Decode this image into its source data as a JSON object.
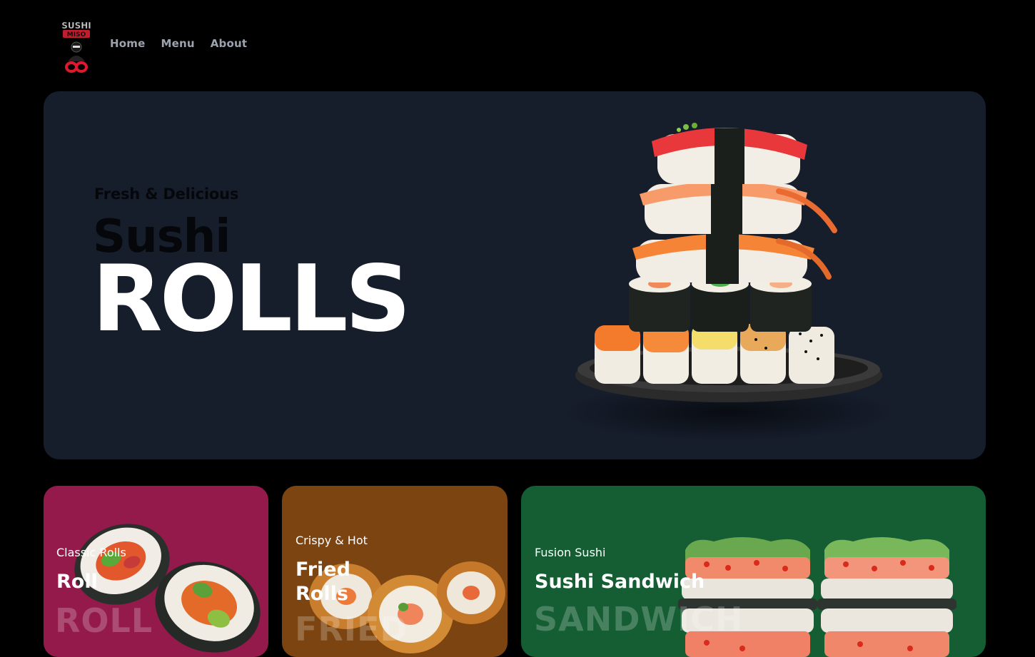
{
  "header": {
    "logo_text_top": "SUSHI",
    "logo_text_bottom": "MISO",
    "nav": [
      {
        "label": "Home"
      },
      {
        "label": "Menu"
      },
      {
        "label": "About"
      }
    ]
  },
  "hero": {
    "tagline": "Fresh & Delicious",
    "title_line1": "Sushi",
    "title_line2": "ROLLS",
    "image_icon": "sushi-tower-plate"
  },
  "cards": [
    {
      "subtitle": "Classic Rolls",
      "title": "Roll",
      "ghost": "ROLL",
      "color": "#941a4c",
      "image_icon": "sushi-burrito"
    },
    {
      "subtitle": "Crispy & Hot",
      "title_line1": "Fried",
      "title_line2": "Rolls",
      "ghost": "FRIED",
      "color": "#7b4410",
      "image_icon": "fried-rolls"
    },
    {
      "subtitle": "Fusion Sushi",
      "title": "Sushi Sandwich",
      "ghost": "SANDWICH",
      "color": "#155e33",
      "image_icon": "sushi-sandwich"
    }
  ],
  "colors": {
    "page_bg": "#000000",
    "hero_bg": "#161d2b",
    "nav_text": "#9ca3af"
  }
}
